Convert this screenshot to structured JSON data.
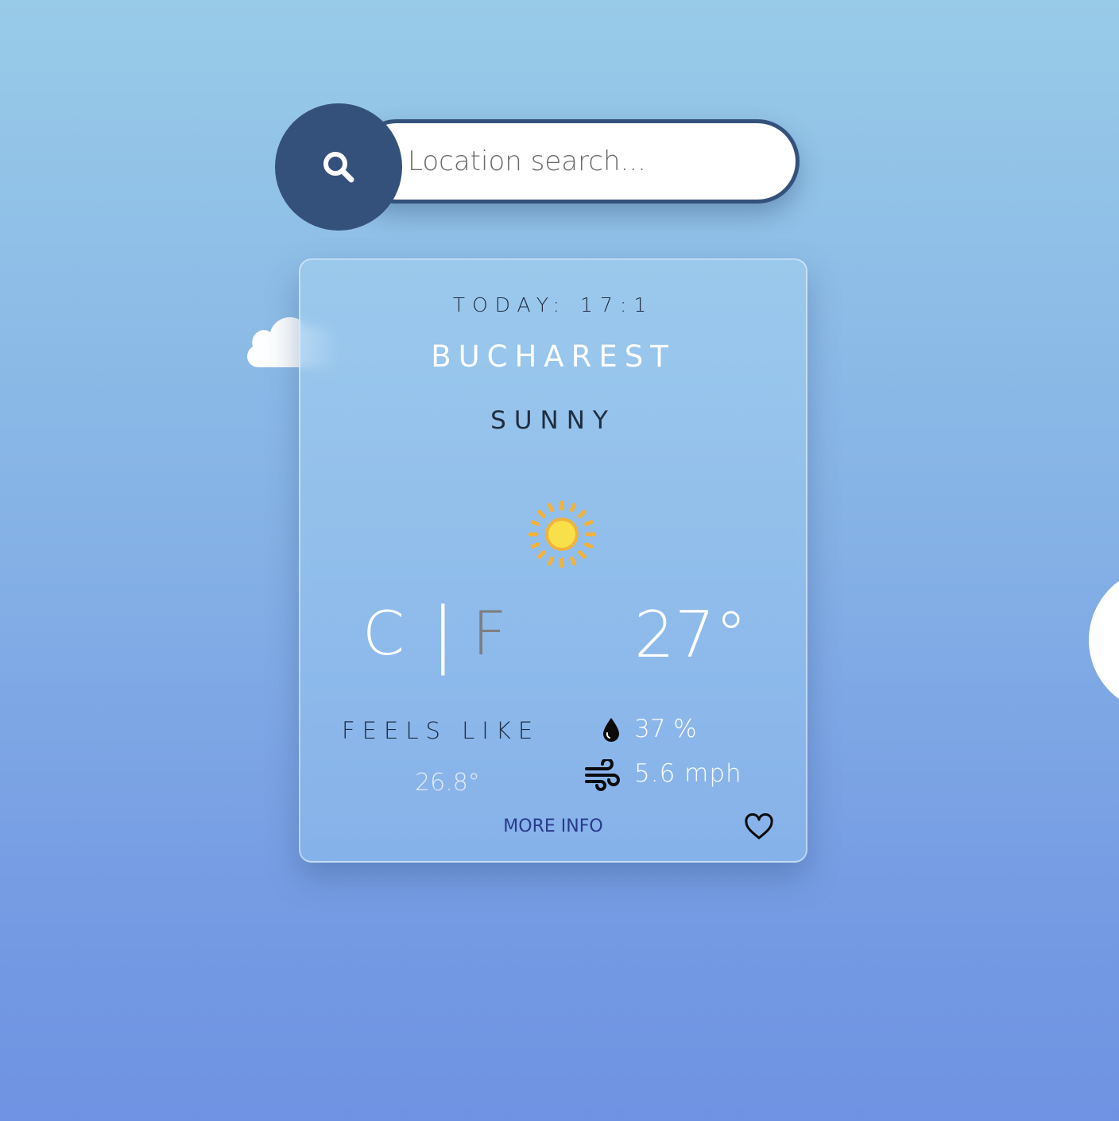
{
  "search": {
    "placeholder": "Location search..."
  },
  "card": {
    "today": "TODAY: 17:1",
    "city": "BUCHAREST",
    "condition": "SUNNY",
    "weather_icon": "sun-icon",
    "unit_c": "C",
    "unit_separator": "|",
    "unit_f": "F",
    "active_unit": "C",
    "temperature": "27°",
    "feels_like_label": "FEELS LIKE",
    "feels_like_value": "26.8°",
    "humidity": "37 %",
    "wind": "5.6 mph",
    "more_info": "MORE INFO"
  },
  "colors": {
    "accent": "#34517c",
    "background_top": "#98cbe8",
    "background_bottom": "#6f93e2",
    "sun": "#f7e04a",
    "sun_rays": "#f3b23a",
    "more_info": "#2a3a8a"
  },
  "icons": [
    "search-icon",
    "sun-icon",
    "drop-icon",
    "wind-icon",
    "heart-icon",
    "cloud-icon"
  ]
}
